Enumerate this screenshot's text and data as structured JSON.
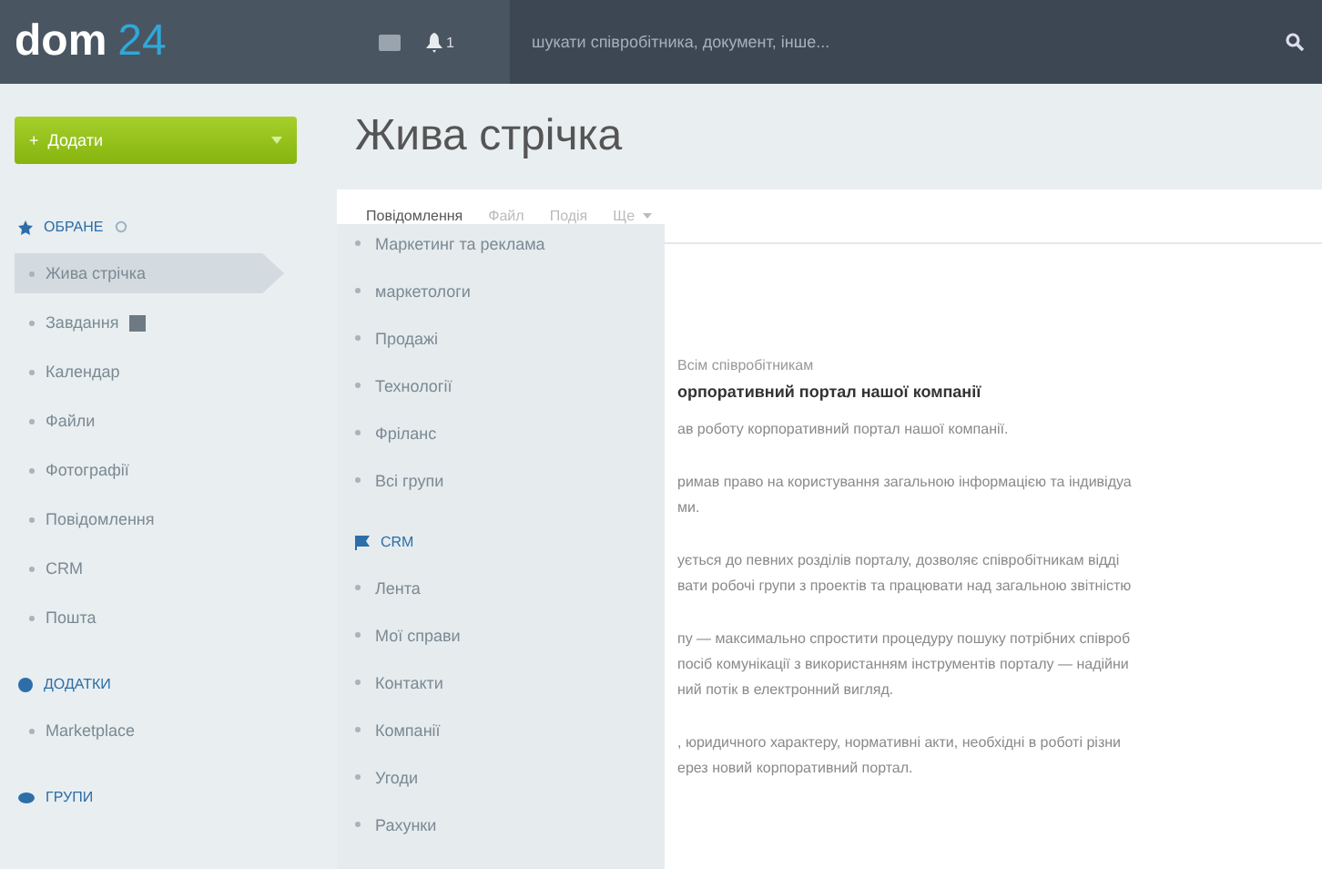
{
  "header": {
    "logo_word": "dom",
    "logo_number": "24",
    "notification_count": "1",
    "search": {
      "placeholder": "шукати співробітника, документ, інше..."
    }
  },
  "add_button": {
    "icon": "+",
    "label": "Додати"
  },
  "page_title": "Жива стрічка",
  "sidebar": {
    "sections": [
      {
        "title": "ОБРАНЕ",
        "items": [
          {
            "label": "Жива стрічка",
            "selected": true
          },
          {
            "label": "Завдання",
            "selected": false,
            "badge": true
          },
          {
            "label": "Календар",
            "selected": false
          },
          {
            "label": "Файли",
            "selected": false
          },
          {
            "label": "Фотографії",
            "selected": false
          },
          {
            "label": "Повідомлення",
            "selected": false
          },
          {
            "label": "CRM",
            "selected": false
          },
          {
            "label": "Пошта",
            "selected": false
          }
        ]
      },
      {
        "title": "ДОДАТКИ",
        "items": [
          {
            "label": "Marketplace",
            "selected": false
          }
        ]
      },
      {
        "title": "ГРУПИ"
      }
    ]
  },
  "tabs": [
    {
      "label": "Повідомлення",
      "selected": true
    },
    {
      "label": "Файл",
      "selected": false
    },
    {
      "label": "Подія",
      "selected": false
    },
    {
      "label": "Ще",
      "selected": false
    }
  ],
  "overlay_menu": {
    "sections": [
      {
        "items": [
          "Маркетинг та реклама",
          "маркетологи",
          "Продажі",
          "Технології",
          "Фріланс",
          "Всі групи"
        ]
      },
      {
        "title": "CRM",
        "items": [
          "Лента",
          "Мої справи",
          "Контакти",
          "Компанії",
          "Угоди",
          "Рахунки"
        ]
      }
    ]
  },
  "post": {
    "recipients": "Всім співробітникам",
    "title": "орпоративний портал нашої компанії",
    "paragraphs": [
      [
        "ав роботу корпоративний портал нашої компанії."
      ],
      [
        "римав право на користування загальною інформацією та індивідуа",
        "ми."
      ],
      [
        "ується до певних розділів порталу, дозволяє співробітникам відді",
        "вати робочі групи з проектів та працювати над загальною звітністю"
      ],
      [
        "пу — максимально спростити процедуру пошуку потрібних співроб",
        "посіб комунікації з використанням інструментів порталу — надійни",
        "ний потік в електронний вигляд."
      ],
      [
        ", юридичного характеру, нормативні акти, необхідні в роботі різни",
        "ерез новий корпоративний портал."
      ]
    ]
  }
}
